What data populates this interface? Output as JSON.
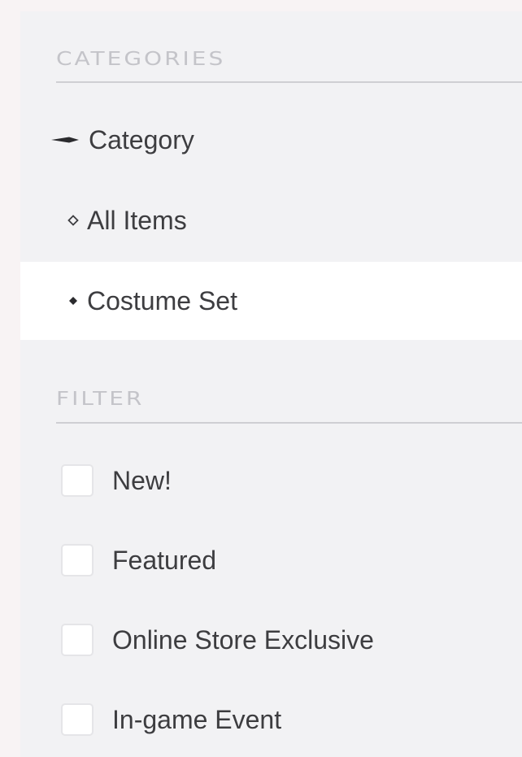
{
  "sidebar": {
    "categories_heading": "CATEGORIES",
    "category_items": [
      {
        "label": "Category",
        "icon": "arrow-right-icon"
      },
      {
        "label": "All Items",
        "icon": "hollow-diamond-icon"
      },
      {
        "label": "Costume Set",
        "icon": "filled-diamond-icon",
        "selected": true
      }
    ],
    "filter_heading": "FILTER",
    "filters": [
      {
        "label": "New!",
        "checked": false
      },
      {
        "label": "Featured",
        "checked": false
      },
      {
        "label": "Online Store Exclusive",
        "checked": false
      },
      {
        "label": "In-game Event",
        "checked": false
      }
    ]
  },
  "colors": {
    "page_background": "#f8f3f4",
    "panel_background": "#f2f2f4",
    "selected_row": "#ffffff",
    "heading_text": "#c4c4c9",
    "body_text": "#3d3d40"
  }
}
